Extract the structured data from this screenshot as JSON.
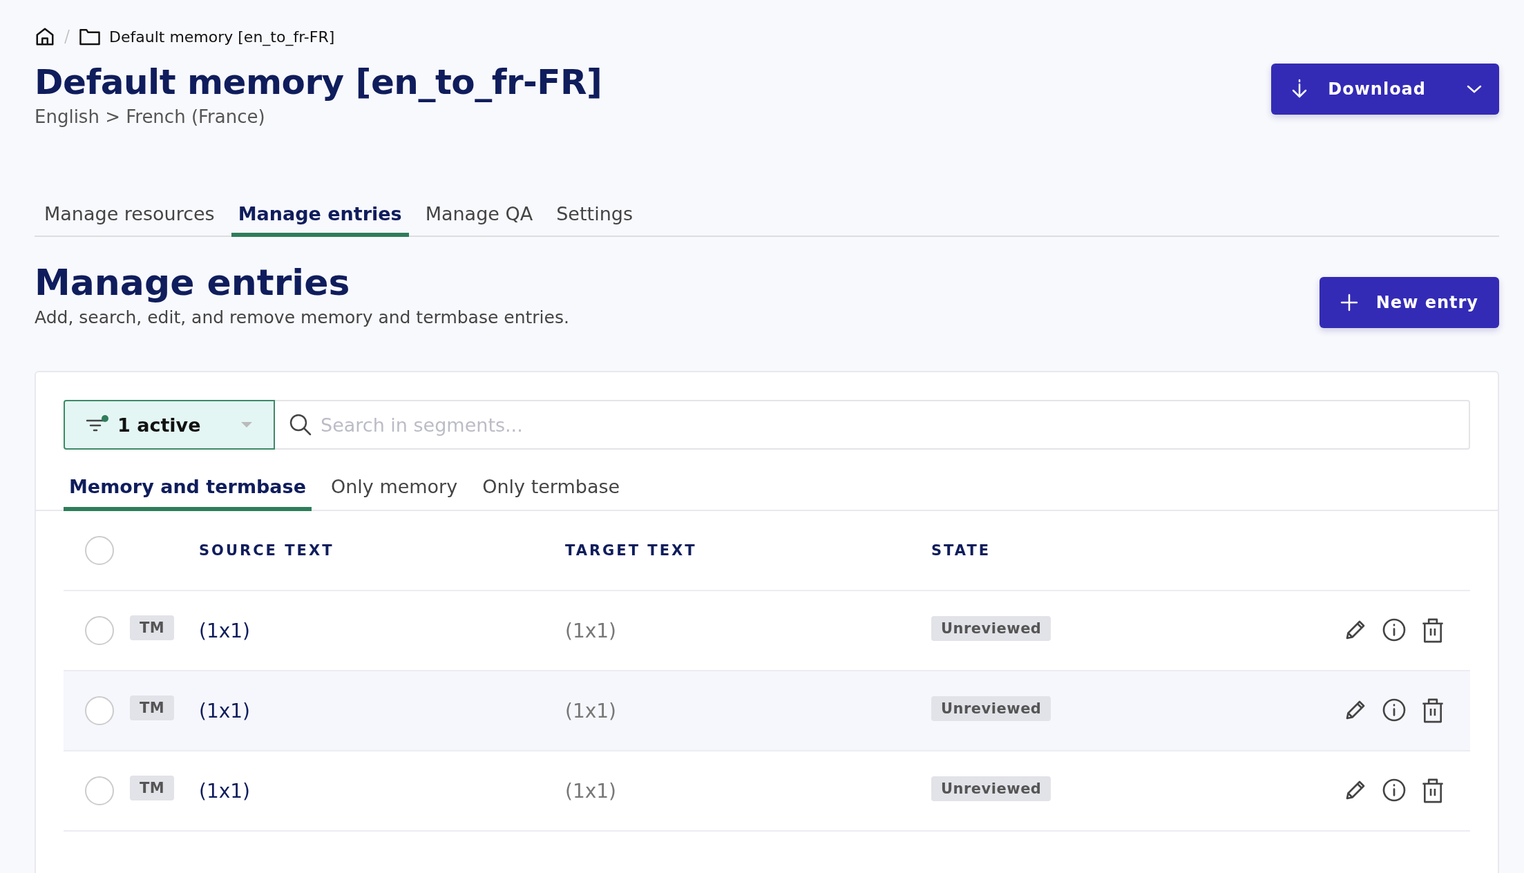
{
  "breadcrumb": {
    "current": "Default memory [en_to_fr-FR]"
  },
  "header": {
    "title": "Default memory [en_to_fr-FR]",
    "subtitle": "English > French (France)",
    "download_button": "Download"
  },
  "tabs": [
    {
      "label": "Manage resources",
      "selected": false
    },
    {
      "label": "Manage entries",
      "selected": true
    },
    {
      "label": "Manage QA",
      "selected": false
    },
    {
      "label": "Settings",
      "selected": false
    }
  ],
  "section": {
    "title": "Manage entries",
    "description": "Add, search, edit, and remove memory and termbase entries.",
    "new_button": "New entry"
  },
  "filter": {
    "label": "1 active",
    "active": true
  },
  "search": {
    "placeholder": "Search in segments..."
  },
  "subtabs": [
    {
      "label": "Memory and termbase",
      "selected": true
    },
    {
      "label": "Only memory",
      "selected": false
    },
    {
      "label": "Only termbase",
      "selected": false
    }
  ],
  "table": {
    "columns": [
      "SOURCE TEXT",
      "TARGET TEXT",
      "STATE"
    ],
    "all_checked": false,
    "rows": [
      {
        "checked": false,
        "type": "TM",
        "source": "(1x1)",
        "target": "(1x1)",
        "state": "Unreviewed"
      },
      {
        "checked": false,
        "type": "TM",
        "source": "(1x1)",
        "target": "(1x1)",
        "state": "Unreviewed"
      },
      {
        "checked": false,
        "type": "TM",
        "source": "(1x1)",
        "target": "(1x1)",
        "state": "Unreviewed"
      }
    ]
  }
}
